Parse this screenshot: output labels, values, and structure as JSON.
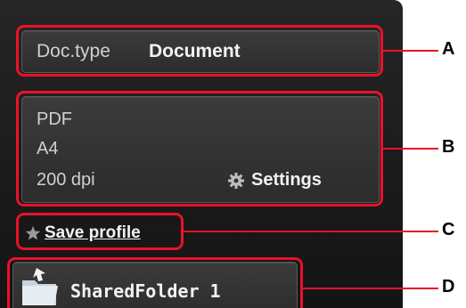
{
  "doc_type": {
    "label": "Doc.type",
    "value": "Document"
  },
  "scan_settings": {
    "format": "PDF",
    "size": "A4",
    "resolution": "200 dpi",
    "settings_label": "Settings",
    "settings_icon": "gear-icon"
  },
  "save_profile": {
    "label": "Save profile",
    "icon": "star-icon"
  },
  "destination": {
    "label": "SharedFolder 1",
    "icon": "shared-folder-icon"
  },
  "callouts": [
    "A",
    "B",
    "C",
    "D"
  ],
  "colors": {
    "callout": "#e8122a",
    "screen_bg": "#1e1e1e",
    "text": "#f2f2f2"
  }
}
